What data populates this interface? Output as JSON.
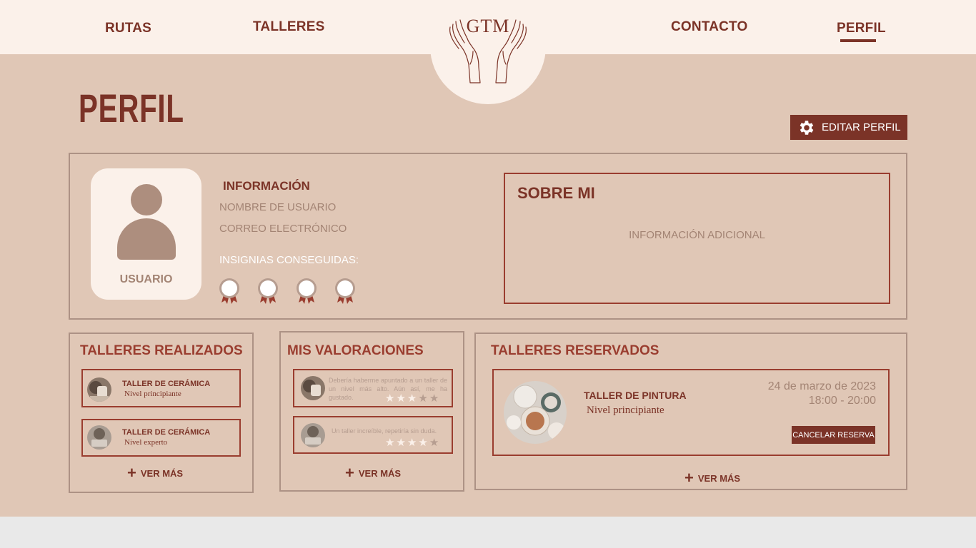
{
  "nav": {
    "rutas": "RUTAS",
    "talleres": "TALLERES",
    "contacto": "CONTACTO",
    "perfil": "PERFIL",
    "logo_text": "GTM"
  },
  "page": {
    "title": "PERFIL",
    "edit_button": "EDITAR PERFIL"
  },
  "profile": {
    "avatar_label": "USUARIO",
    "info_title": "INFORMACIÓN",
    "username_field": "NOMBRE DE USUARIO",
    "email_field": "CORREO ELECTRÓNICO",
    "badges_label": "INSIGNIAS CONSEGUIDAS:",
    "badge_count": 4,
    "about_title": "SOBRE MI",
    "about_info": "INFORMACIÓN ADICIONAL"
  },
  "workshops_done": {
    "title": "TALLERES REALIZADOS",
    "items": [
      {
        "name": "TALLER DE CERÁMICA",
        "level": "Nivel principiante"
      },
      {
        "name": "TALLER DE CERÁMICA",
        "level": "Nivel experto"
      }
    ],
    "see_more": "VER MÁS"
  },
  "reviews": {
    "title": "MIS VALORACIONES",
    "items": [
      {
        "text": "Debería haberme apuntado a un taller de un nivel más alto. Aún así, me ha gustado.",
        "rating": 3,
        "max": 5
      },
      {
        "text": "Un taller increíble, repetiría sin duda.",
        "rating": 4,
        "max": 5
      }
    ],
    "see_more": "VER MÁS"
  },
  "reserved": {
    "title": "TALLERES RESERVADOS",
    "items": [
      {
        "name": "TALLER DE PINTURA",
        "level": "Nivel principiante",
        "date": "24 de marzo de 2023",
        "time": "18:00 - 20:00",
        "cancel": "CANCELAR RESERVA"
      }
    ],
    "see_more": "VER MÁS"
  },
  "colors": {
    "accent": "#7b3327",
    "background": "#e0c7b6",
    "light": "#fbf1ea",
    "muted": "#a38474"
  },
  "icons": [
    "gear-icon",
    "person-icon",
    "badge-icon",
    "plus-icon",
    "star-icon",
    "hands-logo-icon"
  ]
}
